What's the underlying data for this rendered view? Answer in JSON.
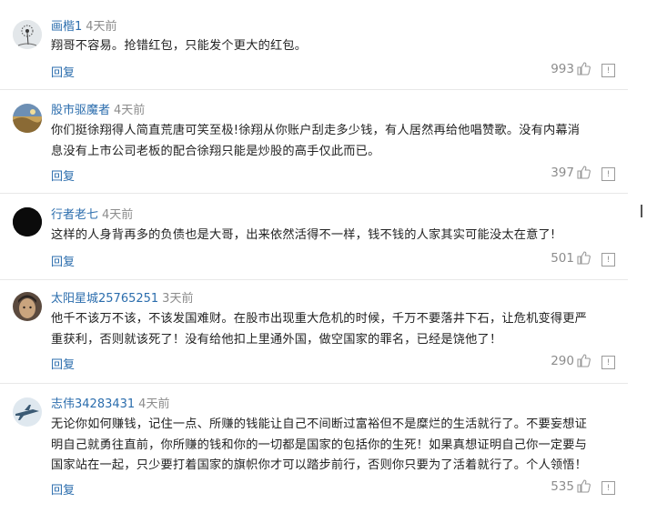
{
  "reply_label": "回复",
  "report_glyph": "!",
  "comments": [
    {
      "user": "画楷1",
      "time": "4天前",
      "lines": [
        "翔哥不容易。抢错红包，只能发个更大的红包。"
      ],
      "likes": "993",
      "avatar": "dandelion-avatar"
    },
    {
      "user": "股市驱魔者",
      "time": "4天前",
      "lines": [
        "你们挺徐翔得人简直荒唐可笑至极!徐翔从你账户刮走多少钱，有人居然再给他唱赞歌。没有内幕消",
        "息没有上市公司老板的配合徐翔只能是炒股的高手仅此而已。"
      ],
      "likes": "397",
      "avatar": "landscape-avatar"
    },
    {
      "user": "行者老七",
      "time": "4天前",
      "lines": [
        "这样的人身背再多的负债也是大哥，出来依然活得不一样，钱不钱的人家其实可能没太在意了!"
      ],
      "likes": "501",
      "avatar": "black-circle-avatar"
    },
    {
      "user": "太阳星城25765251",
      "time": "3天前",
      "lines": [
        "他千不该万不该，不该发国难财。在股市出现重大危机的时候，千万不要落井下石，让危机变得更严",
        "重获利，否则就该死了！没有给他扣上里通外国，做空国家的罪名，已经是饶他了！"
      ],
      "likes": "290",
      "avatar": "face-avatar"
    },
    {
      "user": "志伟34283431",
      "time": "4天前",
      "lines": [
        "无论你如何赚钱，记住一点、所赚的钱能让自己不间断过富裕但不是糜烂的生活就行了。不要妄想证",
        "明自己就勇往直前，你所赚的钱和你的一切都是国家的包括你的生死！如果真想证明自己你一定要与",
        "国家站在一起，只少要打着国家的旗帜你才可以踏步前行，否则你只要为了活着就行了。个人领悟！"
      ],
      "likes": "535",
      "avatar": "jet-avatar"
    }
  ]
}
